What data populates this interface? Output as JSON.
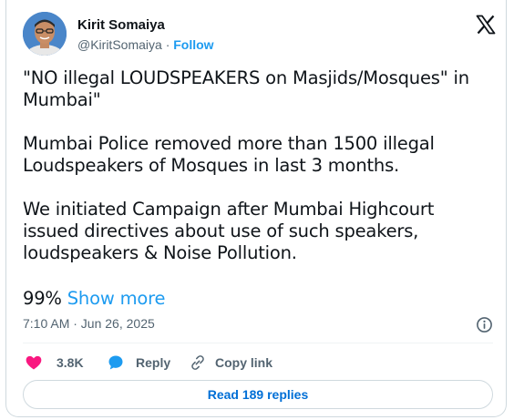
{
  "author": {
    "name": "Kirit Somaiya",
    "handle": "@KiritSomaiya",
    "separator": "·",
    "follow_label": "Follow"
  },
  "tweet": {
    "paragraphs": [
      "\"NO illegal LOUDSPEAKERS on Masjids/Mosques\" in Mumbai\"",
      "Mumbai Police removed more than 1500 illegal Loudspeakers of Mosques in last 3 months.",
      "We initiated Campaign after Mumbai Highcourt issued directives about use of such speakers, loudspeakers & Noise Pollution."
    ],
    "truncated_text": "99%",
    "show_more_label": "Show more",
    "timestamp": "7:10 AM · Jun 26, 2025"
  },
  "actions": {
    "likes_count": "3.8K",
    "reply_label": "Reply",
    "copy_link_label": "Copy link"
  },
  "read_replies_label": "Read 189 replies",
  "icons": {
    "logo": "x-logo-icon",
    "info": "info-icon",
    "like": "heart-icon",
    "reply": "speech-bubble-icon",
    "copy": "link-icon"
  },
  "colors": {
    "accent": "#1d9bf0",
    "like": "#f91880",
    "text": "#0f1419",
    "muted": "#536471"
  }
}
